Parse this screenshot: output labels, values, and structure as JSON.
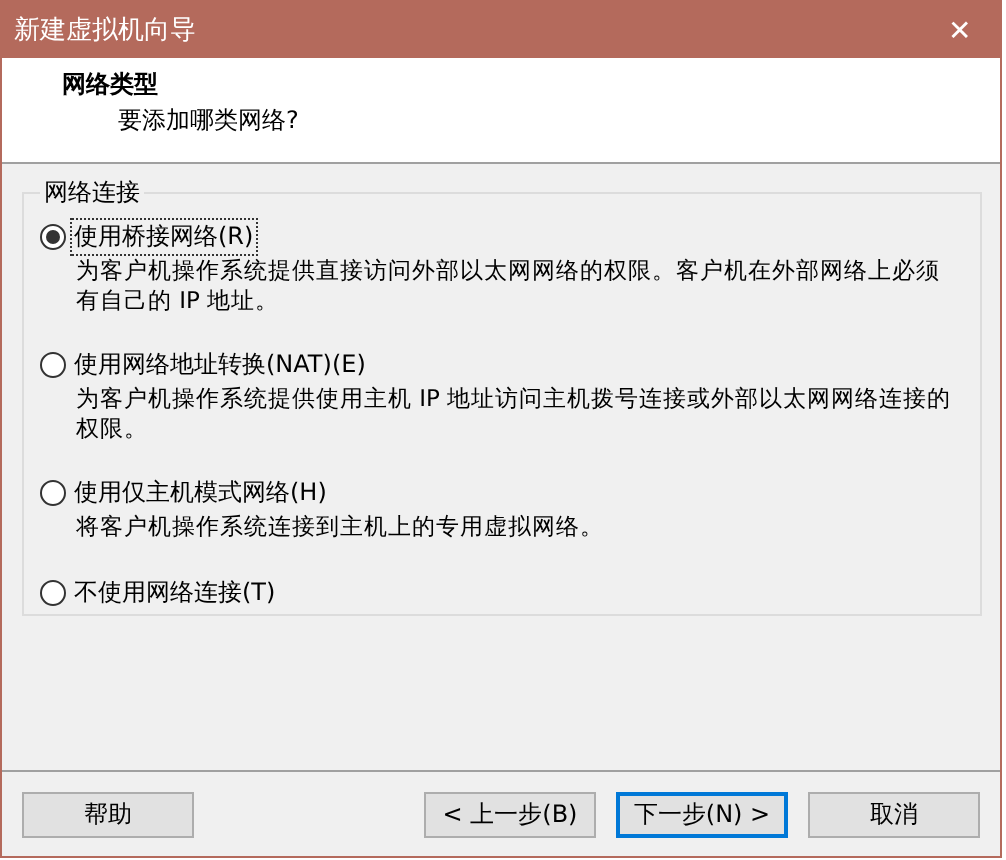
{
  "window": {
    "title": "新建虚拟机向导",
    "close": "✕"
  },
  "header": {
    "title": "网络类型",
    "subtitle": "要添加哪类网络?"
  },
  "group": {
    "title": "网络连接",
    "options": [
      {
        "label": "使用桥接网络(R)",
        "description": "为客户机操作系统提供直接访问外部以太网网络的权限。客户机在外部网络上必须有自己的 IP 地址。",
        "selected": true
      },
      {
        "label": "使用网络地址转换(NAT)(E)",
        "description": "为客户机操作系统提供使用主机 IP 地址访问主机拨号连接或外部以太网网络连接的权限。",
        "selected": false
      },
      {
        "label": "使用仅主机模式网络(H)",
        "description": "将客户机操作系统连接到主机上的专用虚拟网络。",
        "selected": false
      },
      {
        "label": "不使用网络连接(T)",
        "selected": false
      }
    ]
  },
  "buttons": [
    {
      "label": "帮助",
      "kind": "help",
      "default": false
    },
    {
      "label": "< 上一步(B)",
      "kind": "nav",
      "default": false
    },
    {
      "label": "下一步(N) >",
      "kind": "nav",
      "default": true
    },
    {
      "label": "取消",
      "kind": "nav",
      "default": false
    }
  ]
}
